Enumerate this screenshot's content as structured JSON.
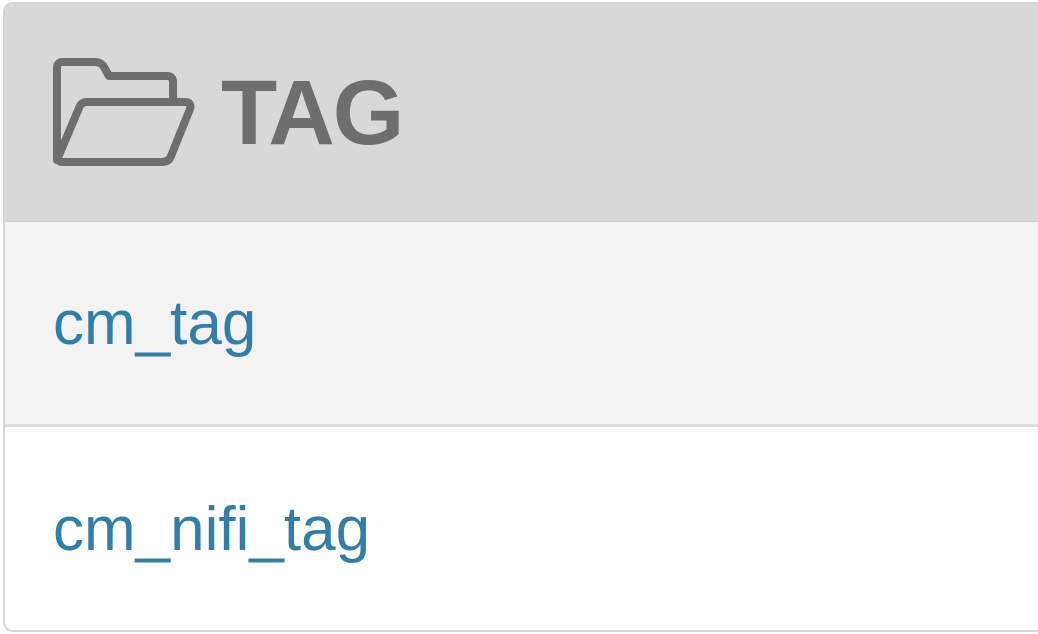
{
  "panel": {
    "header": {
      "icon": "folder-open-icon",
      "title": "TAG"
    },
    "items": [
      {
        "label": "cm_tag"
      },
      {
        "label": "cm_nifi_tag"
      }
    ]
  },
  "colors": {
    "header_bg": "#d8d8d8",
    "header_text": "#6e6e6e",
    "link": "#337ea9",
    "stripe": "#f3f3f3",
    "border": "#d6d6d6"
  }
}
